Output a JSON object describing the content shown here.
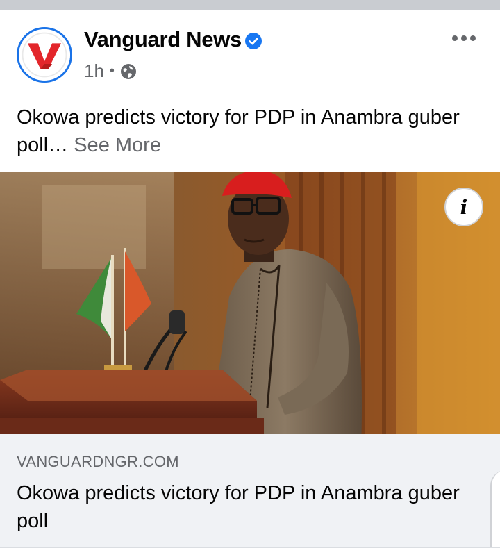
{
  "post": {
    "page_name": "Vanguard News",
    "verified_icon": "verified-badge-icon",
    "timestamp": "1h",
    "separator": "•",
    "audience_icon": "globe-icon",
    "text": "Okowa predicts victory for PDP in Anambra guber poll…",
    "see_more_label": "See More",
    "more_icon": "more-options-icon"
  },
  "avatar": {
    "logo_letter": "V",
    "logo_color": "#e3262b",
    "ring_color": "#1a73e8"
  },
  "photo": {
    "info_label": "i",
    "description_icon": "photo"
  },
  "link_preview": {
    "domain": "VANGUARDNGR.COM",
    "title": "Okowa predicts victory for PDP in Anambra guber poll"
  },
  "colors": {
    "secondary_text": "#65676b",
    "verified_blue": "#1877f2",
    "preview_bg": "#f0f2f5"
  }
}
